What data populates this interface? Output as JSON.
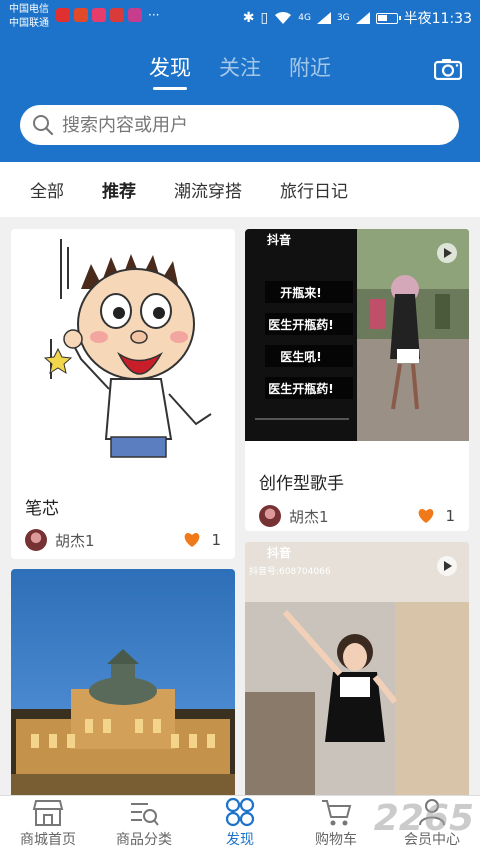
{
  "status_bar": {
    "carrier_1": "中国电信",
    "carrier_2": "中国联通",
    "signal_1": "4G",
    "signal_2": "3G",
    "time": "半夜11:33",
    "battery_level": 0.55
  },
  "top_tabs": [
    {
      "label": "发现",
      "active": true
    },
    {
      "label": "关注",
      "active": false
    },
    {
      "label": "附近",
      "active": false
    }
  ],
  "search": {
    "placeholder": "搜索内容或用户"
  },
  "categories": [
    {
      "label": "全部",
      "active": false
    },
    {
      "label": "推荐",
      "active": true
    },
    {
      "label": "潮流穿搭",
      "active": false
    },
    {
      "label": "旅行日记",
      "active": false
    }
  ],
  "cards": [
    {
      "title": "笔芯",
      "author": "胡杰1",
      "likes": "1",
      "image": "cartoon-boy"
    },
    {
      "title": "创作型歌手",
      "author": "胡杰1",
      "likes": "1",
      "image": "video-singer",
      "overlay": {
        "brand": "抖音",
        "lines": [
          "开瓶来!",
          "医生开瓶药!",
          "医生吼!",
          "医生开瓶药!"
        ]
      }
    },
    {
      "title": "",
      "author": "",
      "likes": "",
      "image": "palace"
    },
    {
      "title": "",
      "author": "",
      "likes": "",
      "image": "video-girl",
      "overlay": {
        "brand": "抖音",
        "id_text": "抖音号:608704066"
      }
    }
  ],
  "bottom_nav": [
    {
      "label": "商城首页",
      "icon": "store-icon",
      "active": false
    },
    {
      "label": "商品分类",
      "icon": "category-icon",
      "active": false
    },
    {
      "label": "发现",
      "icon": "discover-icon",
      "active": true
    },
    {
      "label": "购物车",
      "icon": "cart-icon",
      "active": false
    },
    {
      "label": "会员中心",
      "icon": "member-icon",
      "active": false
    }
  ],
  "watermark": "2265",
  "colors": {
    "brand_blue": "#1d73c9",
    "like_orange": "#f07a1a"
  }
}
